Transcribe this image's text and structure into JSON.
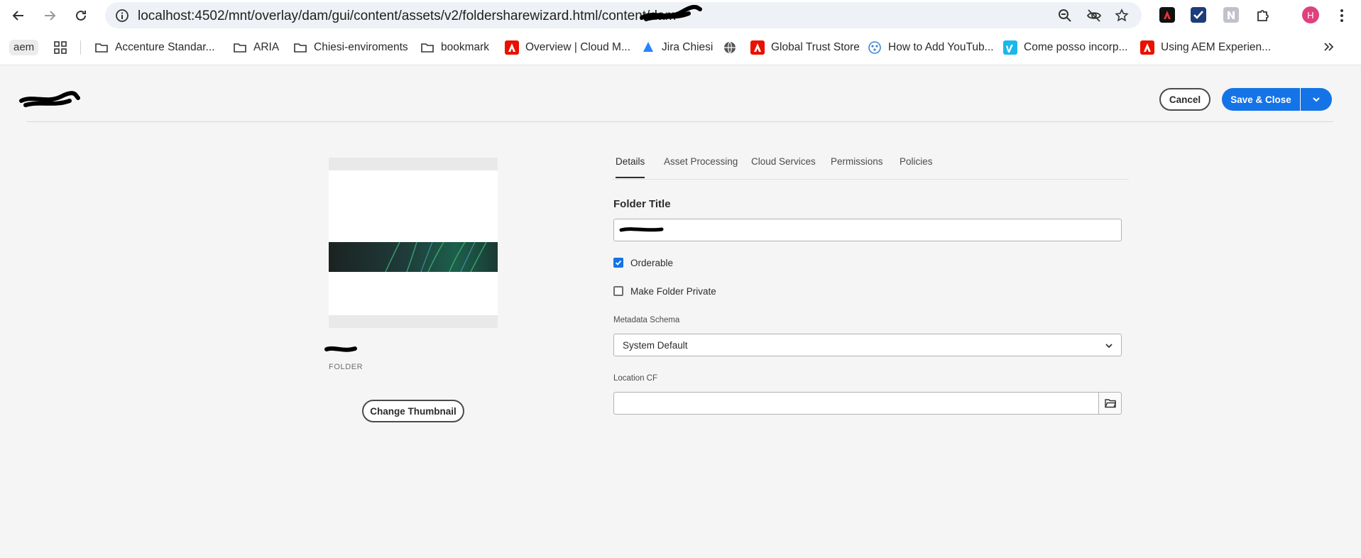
{
  "browser": {
    "url": "localhost:4502/mnt/overlay/dam/gui/content/assets/v2/foldersharewizard.html/content/dam",
    "avatar_initial": "H",
    "bookmarks": [
      {
        "label": "aem"
      },
      {
        "label": "Accenture Standar...",
        "icon": "folder-icon"
      },
      {
        "label": "ARIA",
        "icon": "folder-icon"
      },
      {
        "label": "Chiesi-enviroments",
        "icon": "folder-icon"
      },
      {
        "label": "bookmark",
        "icon": "folder-icon"
      },
      {
        "label": "Overview | Cloud M...",
        "icon": "adobe-icon"
      },
      {
        "label": "Jira Chiesi",
        "icon": "jira-icon"
      },
      {
        "label": "",
        "icon": "globe-icon"
      },
      {
        "label": "Global Trust Store",
        "icon": "adobe-icon"
      },
      {
        "label": "How to Add YouTub...",
        "icon": "youtube-dots-icon"
      },
      {
        "label": "Come posso incorp...",
        "icon": "vimeo-icon"
      },
      {
        "label": "Using AEM Experien...",
        "icon": "adobe-icon"
      }
    ]
  },
  "header": {
    "title": "",
    "cancel_label": "Cancel",
    "save_label": "Save & Close"
  },
  "asset": {
    "type_label": "FOLDER",
    "change_thumbnail_label": "Change Thumbnail"
  },
  "tabs": [
    {
      "label": "Details",
      "active": true
    },
    {
      "label": "Asset Processing",
      "active": false
    },
    {
      "label": "Cloud Services",
      "active": false
    },
    {
      "label": "Permissions",
      "active": false
    },
    {
      "label": "Policies",
      "active": false
    }
  ],
  "form": {
    "folder_title_label": "Folder Title",
    "folder_title_value": "",
    "orderable_label": "Orderable",
    "orderable_checked": true,
    "private_label": "Make Folder Private",
    "private_checked": false,
    "metadata_schema_label": "Metadata Schema",
    "metadata_schema_value": "System Default",
    "location_cf_label": "Location CF",
    "location_cf_value": ""
  },
  "colors": {
    "accent": "#1473e6",
    "background": "#f5f5f5"
  }
}
